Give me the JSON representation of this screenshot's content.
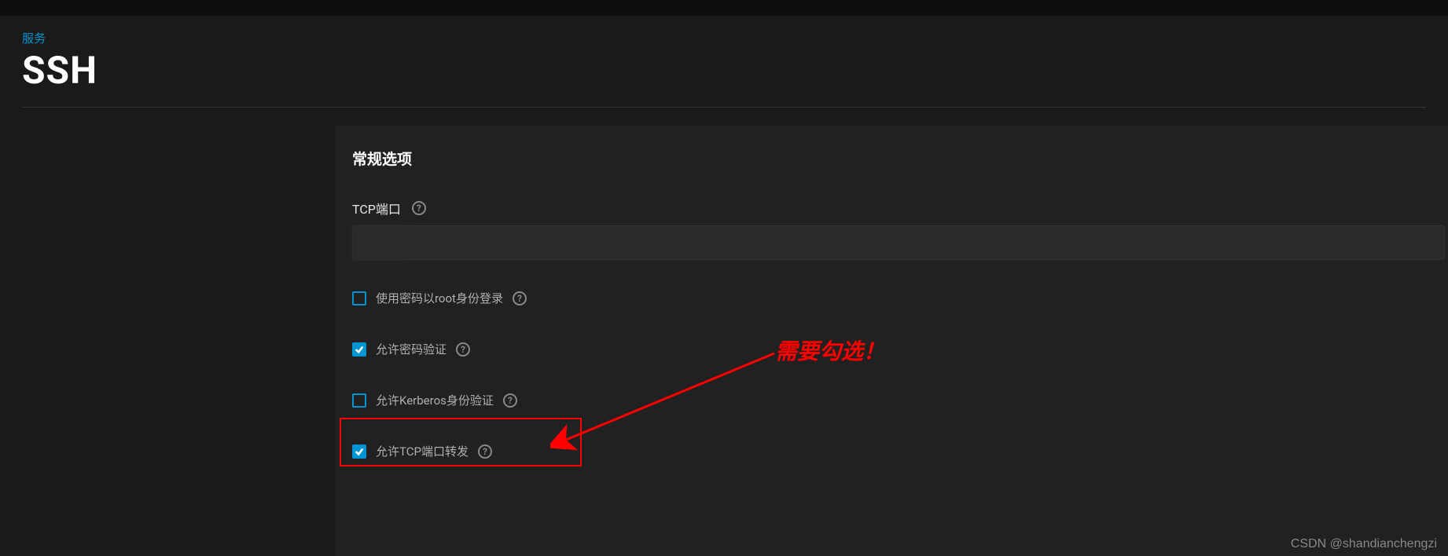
{
  "header": {
    "breadcrumb": "服务",
    "title": "SSH"
  },
  "panel": {
    "title": "常规选项",
    "tcp_port": {
      "label": "TCP端口",
      "value": ""
    },
    "options": [
      {
        "label": "使用密码以root身份登录",
        "checked": false
      },
      {
        "label": "允许密码验证",
        "checked": true
      },
      {
        "label": "允许Kerberos身份验证",
        "checked": false
      },
      {
        "label": "允许TCP端口转发",
        "checked": true
      }
    ]
  },
  "help_glyph": "?",
  "annotation": {
    "text": "需要勾选！"
  },
  "watermark": "CSDN @shandianchengzi"
}
